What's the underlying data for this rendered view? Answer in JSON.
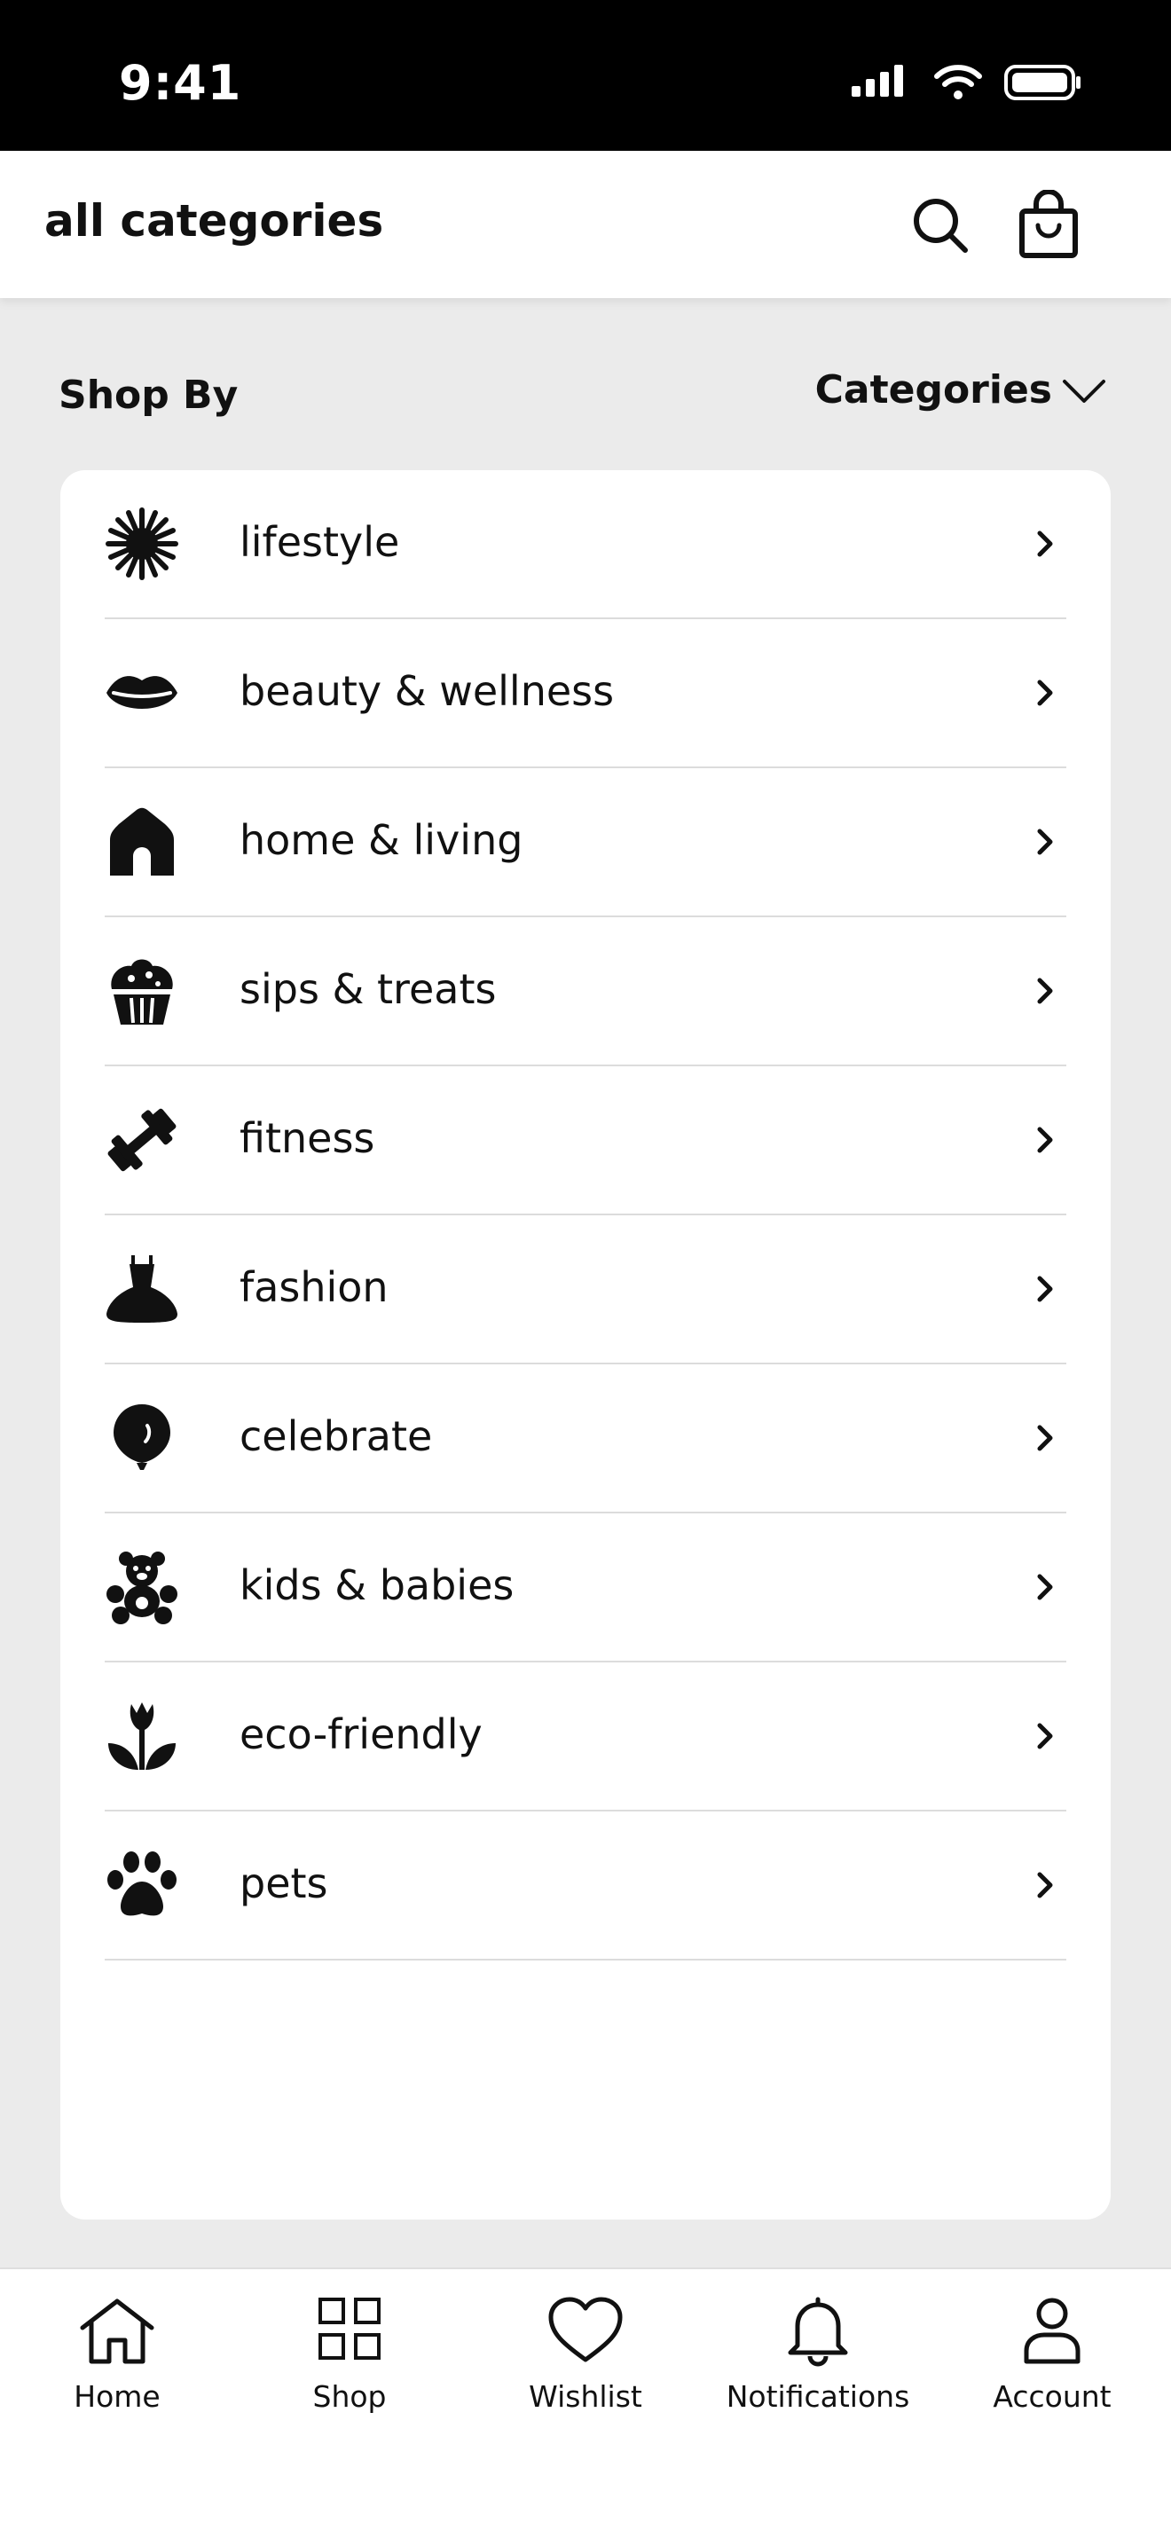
{
  "status_bar": {
    "time": "9:41"
  },
  "header": {
    "title": "all categories"
  },
  "shop_by": {
    "label": "Shop By",
    "dropdown_value": "Categories"
  },
  "categories": [
    {
      "label": "lifestyle",
      "icon": "sun-icon"
    },
    {
      "label": "beauty & wellness",
      "icon": "lips-icon"
    },
    {
      "label": "home & living",
      "icon": "house-icon"
    },
    {
      "label": "sips & treats",
      "icon": "cupcake-icon"
    },
    {
      "label": "fitness",
      "icon": "dumbbell-icon"
    },
    {
      "label": "fashion",
      "icon": "dress-icon"
    },
    {
      "label": "celebrate",
      "icon": "balloon-icon"
    },
    {
      "label": "kids & babies",
      "icon": "teddy-bear-icon"
    },
    {
      "label": "eco-friendly",
      "icon": "plant-icon"
    },
    {
      "label": "pets",
      "icon": "paw-icon"
    }
  ],
  "bottom_nav": [
    {
      "label": "Home",
      "icon": "home-icon"
    },
    {
      "label": "Shop",
      "icon": "grid-icon"
    },
    {
      "label": "Wishlist",
      "icon": "heart-icon"
    },
    {
      "label": "Notifications",
      "icon": "bell-icon"
    },
    {
      "label": "Account",
      "icon": "user-icon"
    }
  ]
}
